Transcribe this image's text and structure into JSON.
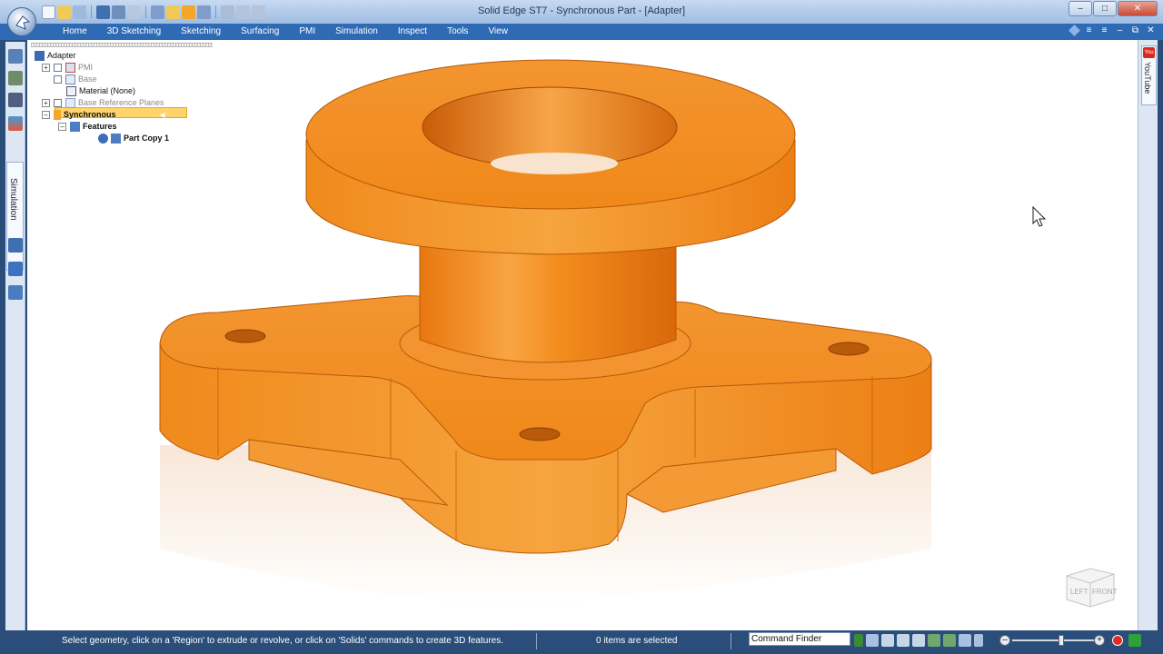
{
  "window": {
    "title": "Solid Edge ST7 - Synchronous Part - [Adapter]",
    "controls": [
      "minimize",
      "maximize",
      "close"
    ]
  },
  "ribbon": {
    "tabs": [
      "Home",
      "3D Sketching",
      "Sketching",
      "Surfacing",
      "PMI",
      "Simulation",
      "Inspect",
      "Tools",
      "View"
    ]
  },
  "left_panel": {
    "docked_tab": "Simulation"
  },
  "right_panel": {
    "docked_tab": "YouTube",
    "logo_text": "You Tube"
  },
  "pathfinder": {
    "items": [
      {
        "label": "Adapter",
        "level": 0
      },
      {
        "label": "PMI",
        "level": 1,
        "checked": false,
        "greyed": true
      },
      {
        "label": "Base",
        "level": 1,
        "checked": false,
        "greyed": true
      },
      {
        "label": "Material (None)",
        "level": 1
      },
      {
        "label": "Base Reference Planes",
        "level": 1,
        "checked": false,
        "greyed": true
      },
      {
        "label": "Synchronous",
        "level": 1,
        "highlighted": true
      },
      {
        "label": "Features",
        "level": 2
      },
      {
        "label": "Part Copy 1",
        "level": 3
      }
    ]
  },
  "viewcube": {
    "faces": [
      "LEFT",
      "FRONT"
    ]
  },
  "statusbar": {
    "prompt": "Select geometry, click on a 'Region' to extrude or revolve, or click on 'Solids' commands to create 3D features.",
    "selection_count": "0 items are selected",
    "command_finder": "Command Finder",
    "zoom_level": 0.6
  },
  "colors": {
    "part": "#f08a1c",
    "tab_bar": "#2f6bb5",
    "status_bar": "#2b4d7a",
    "tree_highlight": "#ffd46b"
  }
}
